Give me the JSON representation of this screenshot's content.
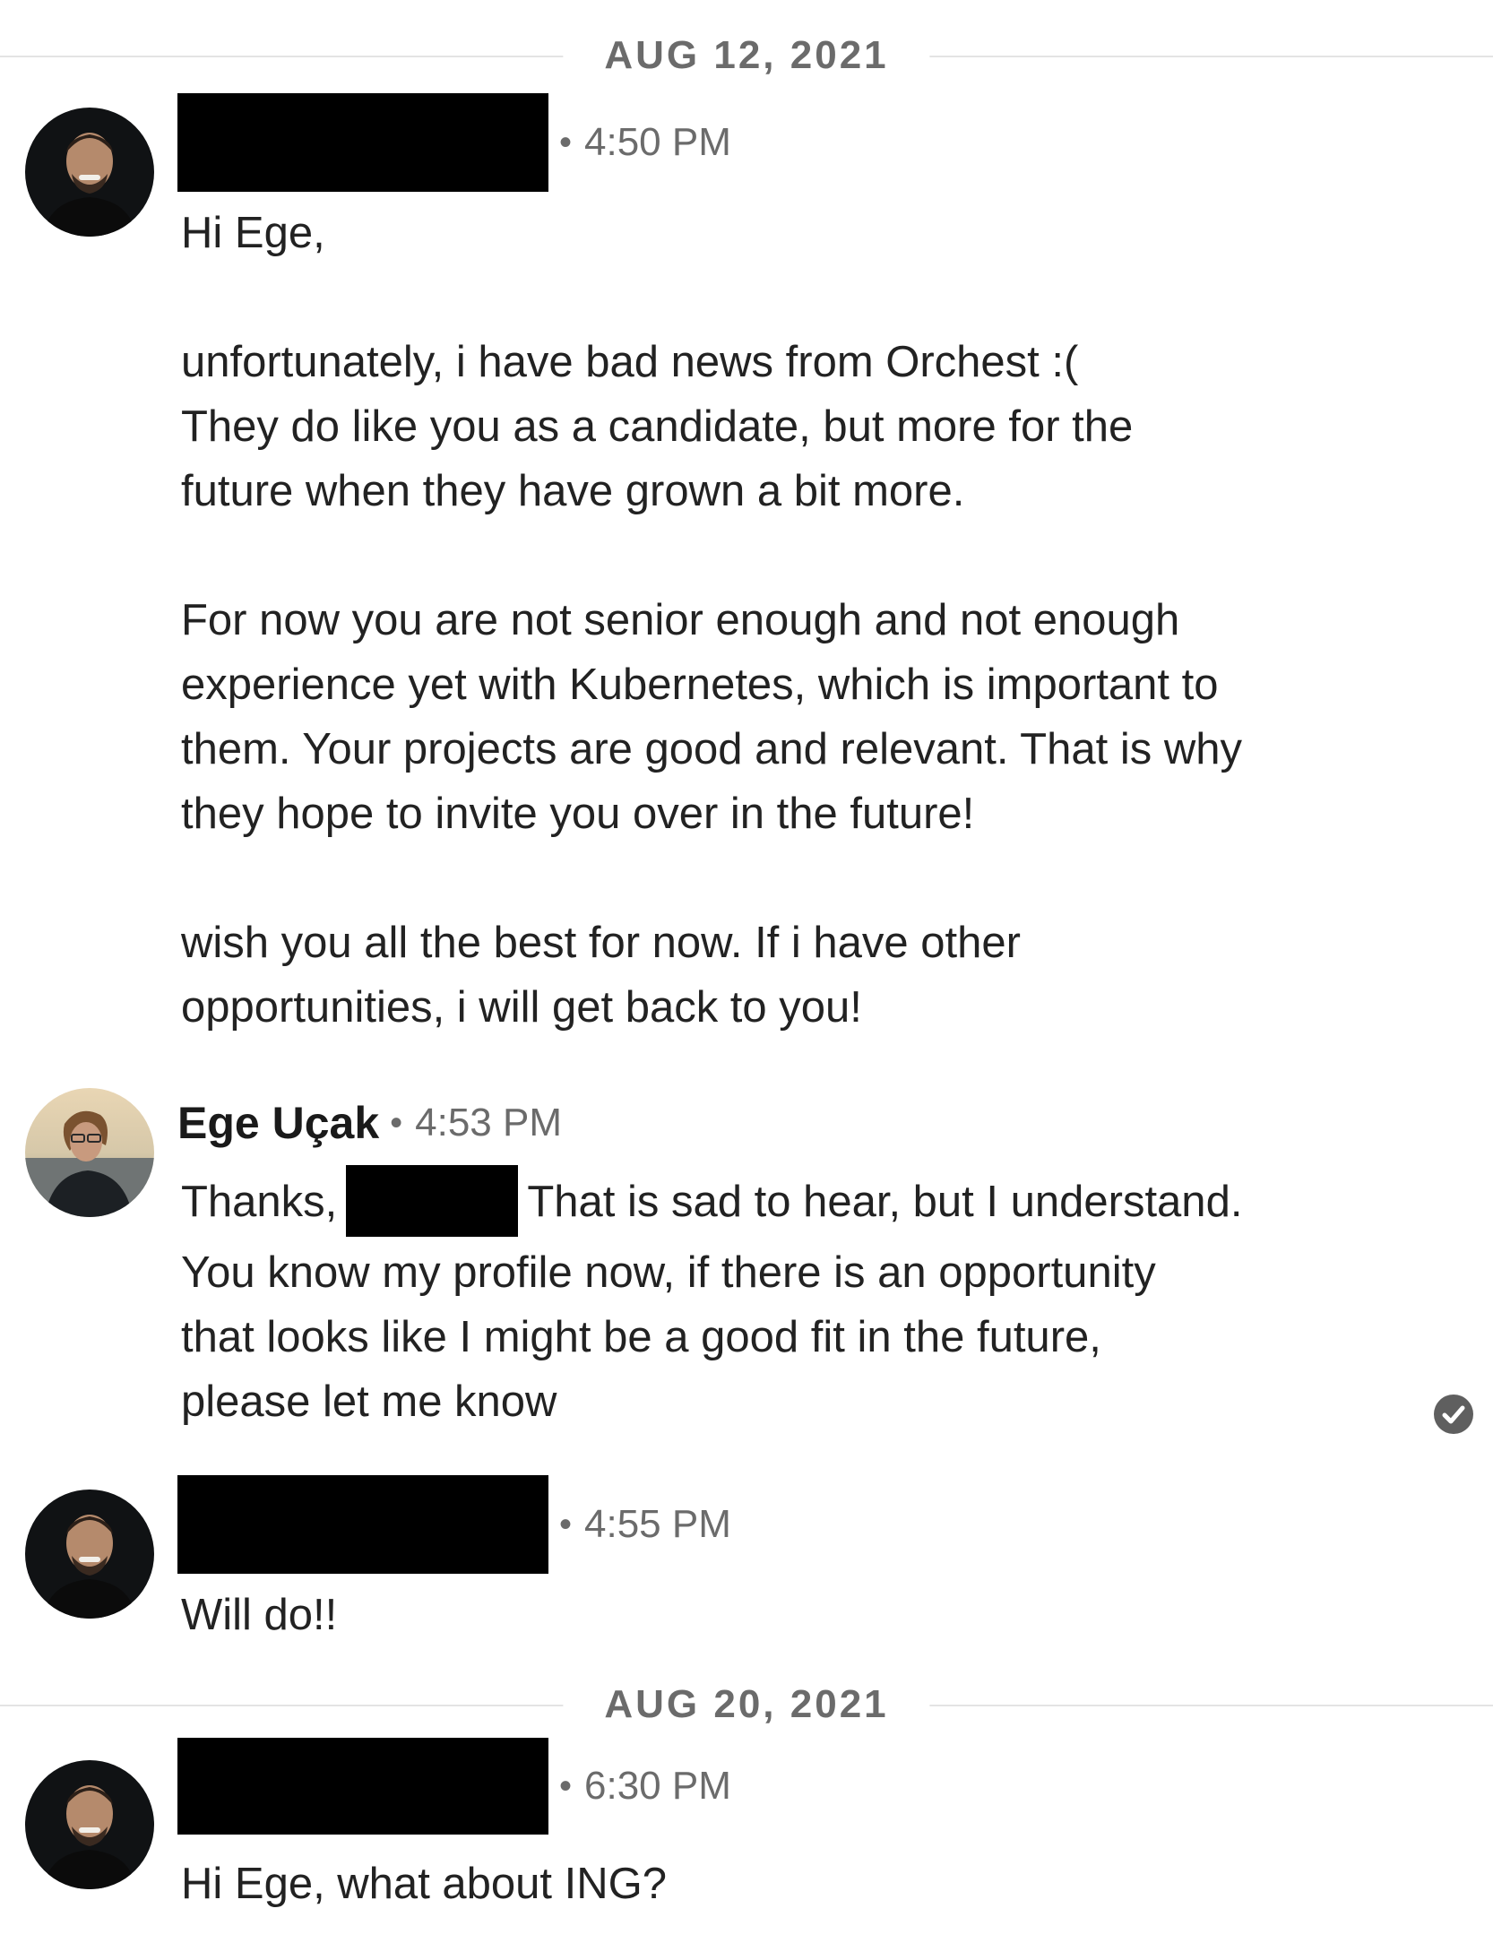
{
  "dividers": [
    {
      "label": "AUG 12, 2021"
    },
    {
      "label": "AUG 20, 2021"
    }
  ],
  "messages": [
    {
      "sender_redacted": true,
      "dot": "•",
      "time": "4:50 PM",
      "paragraphs": [
        "Hi Ege,",
        "unfortunately, i have bad news from Orchest :(\nThey do like you as a candidate, but more for the\nfuture when they have grown a bit more.",
        "For now you are not senior enough and not enough\nexperience yet with Kubernetes, which is important to\nthem. Your projects are good and relevant. That is why\nthey hope to invite you over in the future!",
        "wish you all the best for now. If i have other\nopportunities, i will get back to you!"
      ]
    },
    {
      "sender": "Ege Uçak",
      "dot": "•",
      "time": "4:53 PM",
      "text_before": "Thanks,",
      "text_after": "That is sad to hear, but I understand.",
      "text_rest": "You know my profile now, if there is an opportunity\nthat looks like I might be a good fit in the future,\nplease let me know",
      "read_icon": "checkmark-circle-icon"
    },
    {
      "sender_redacted": true,
      "dot": "•",
      "time": "4:55 PM",
      "paragraphs": [
        "Will do!!"
      ]
    },
    {
      "sender_redacted": true,
      "dot": "•",
      "time": "6:30 PM",
      "paragraphs": [
        "Hi Ege, what about ING?"
      ]
    }
  ]
}
